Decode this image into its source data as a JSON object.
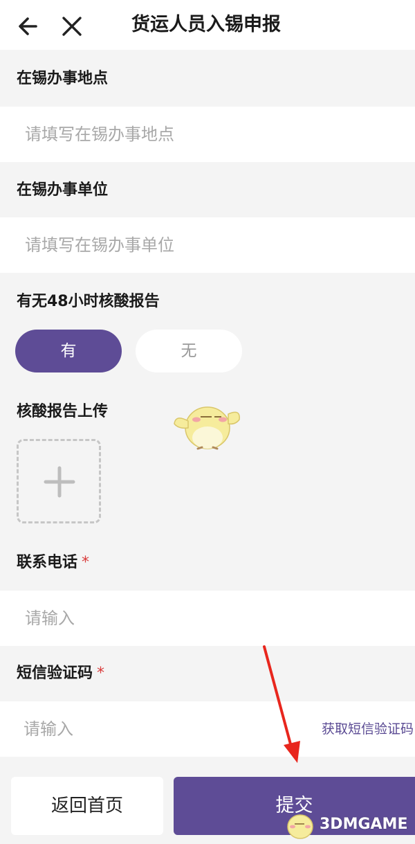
{
  "header": {
    "title": "货运人员入锡申报",
    "back_icon": "arrow-left-icon",
    "close_icon": "close-icon"
  },
  "sections": {
    "location": {
      "label": "在锡办事地点",
      "placeholder": "请填写在锡办事地点"
    },
    "unit": {
      "label": "在锡办事单位",
      "placeholder": "请填写在锡办事单位"
    },
    "nucleic": {
      "label": "有无48小时核酸报告",
      "options": [
        "有",
        "无"
      ],
      "selected": "有"
    },
    "upload": {
      "label": "核酸报告上传",
      "icon": "plus-icon"
    },
    "phone": {
      "label": "联系电话",
      "required_mark": "*",
      "placeholder": "请输入"
    },
    "sms": {
      "label": "短信验证码",
      "required_mark": "*",
      "placeholder": "请输入",
      "get_code": "获取短信验证码"
    }
  },
  "footer": {
    "home_label": "返回首页",
    "submit_label": "提交"
  },
  "watermark": {
    "text": "3DMGAME"
  },
  "colors": {
    "accent": "#5e4c96",
    "background": "#f4f4f4",
    "required": "#d93b3b",
    "annotation_arrow": "#e8261d"
  }
}
